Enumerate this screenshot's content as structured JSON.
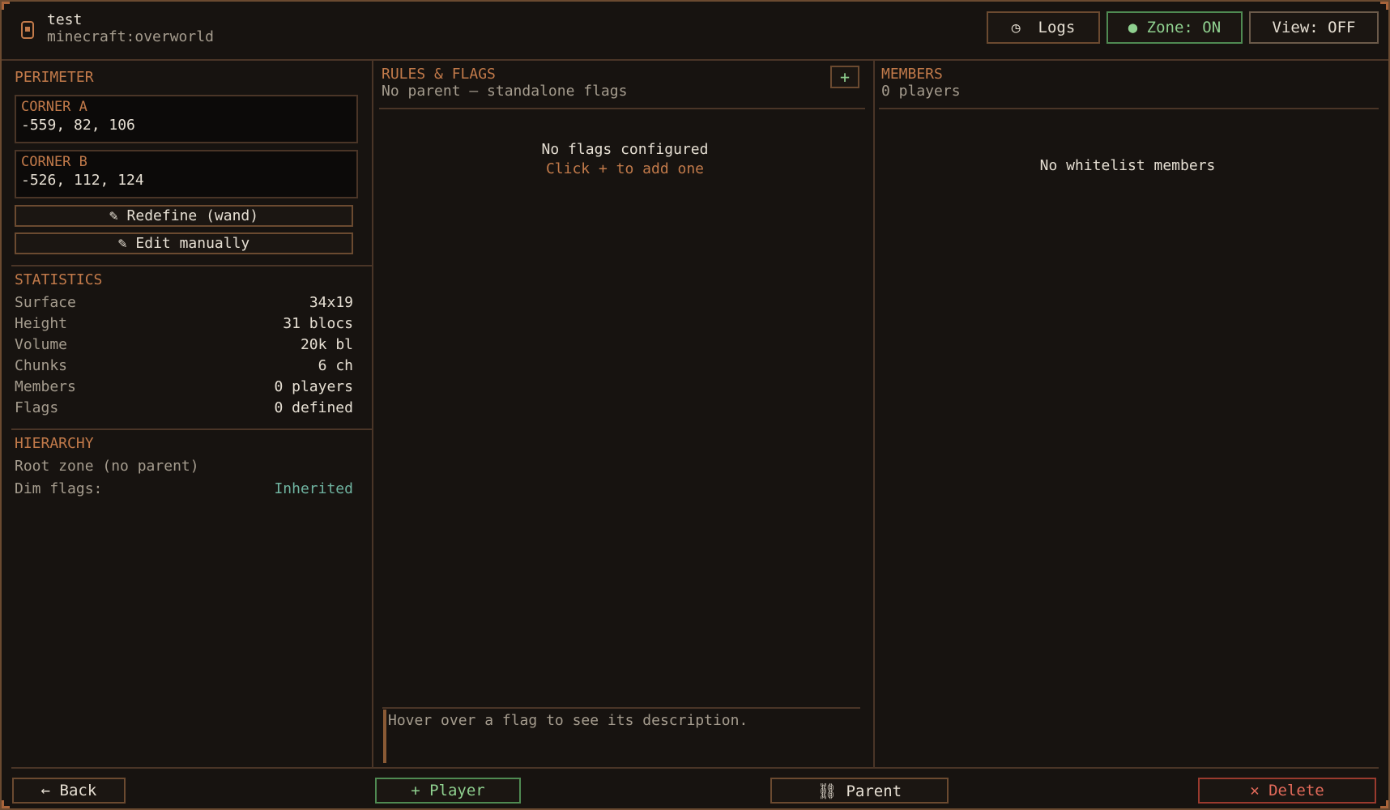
{
  "header": {
    "zone_name": "test",
    "dimension": "minecraft:overworld",
    "logs_label": "Logs",
    "zone_toggle_label": "● Zone: ON",
    "view_toggle_label": "View: OFF"
  },
  "perimeter": {
    "title": "PERIMETER",
    "corner_a_label": "CORNER A",
    "corner_a_value": "-559, 82, 106",
    "corner_b_label": "CORNER B",
    "corner_b_value": "-526, 112, 124",
    "redefine_label": "✎ Redefine (wand)",
    "edit_label": "✎ Edit manually"
  },
  "statistics": {
    "title": "STATISTICS",
    "rows": [
      {
        "key": "Surface",
        "value": "34x19"
      },
      {
        "key": "Height",
        "value": "31 blocs"
      },
      {
        "key": "Volume",
        "value": "20k bl"
      },
      {
        "key": "Chunks",
        "value": "6 ch"
      },
      {
        "key": "Members",
        "value": "0 players"
      },
      {
        "key": "Flags",
        "value": "0 defined"
      }
    ]
  },
  "hierarchy": {
    "title": "HIERARCHY",
    "root_text": "Root zone (no parent)",
    "dim_flags_label": "Dim flags:",
    "dim_flags_value": "Inherited"
  },
  "rules": {
    "title": "RULES & FLAGS",
    "subtitle": "No parent — standalone flags",
    "add_label": "+",
    "empty_title": "No flags configured",
    "empty_hint": "Click + to add one",
    "description": "Hover over a flag to see its description."
  },
  "members": {
    "title": "MEMBERS",
    "subtitle": "0 players",
    "empty": "No whitelist members"
  },
  "footer": {
    "back_label": "← Back",
    "player_label": "+ Player",
    "parent_label": "⛓ Parent",
    "delete_label": "✕ Delete"
  },
  "colors": {
    "accent": "#c27a4a",
    "green": "#8fd08f",
    "red": "#e26a5a",
    "teal": "#6fb3a0"
  }
}
